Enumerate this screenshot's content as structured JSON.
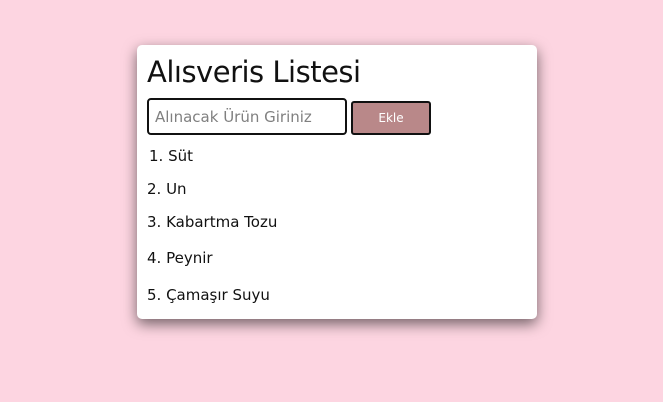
{
  "app": {
    "title": "Alısveris Listesi"
  },
  "form": {
    "input_value": "",
    "input_placeholder": "Alınacak Ürün Giriniz",
    "add_label": "Ekle"
  },
  "list": {
    "items": [
      "1. Süt",
      "2. Un",
      "3. Kabartma Tozu",
      "4. Peynir",
      "5. Çamaşır Suyu"
    ]
  },
  "colors": {
    "page_background": "#fdd5e1",
    "card_background": "#ffffff",
    "button_background": "#b98889",
    "button_text": "#ffffff",
    "border": "#111111"
  }
}
